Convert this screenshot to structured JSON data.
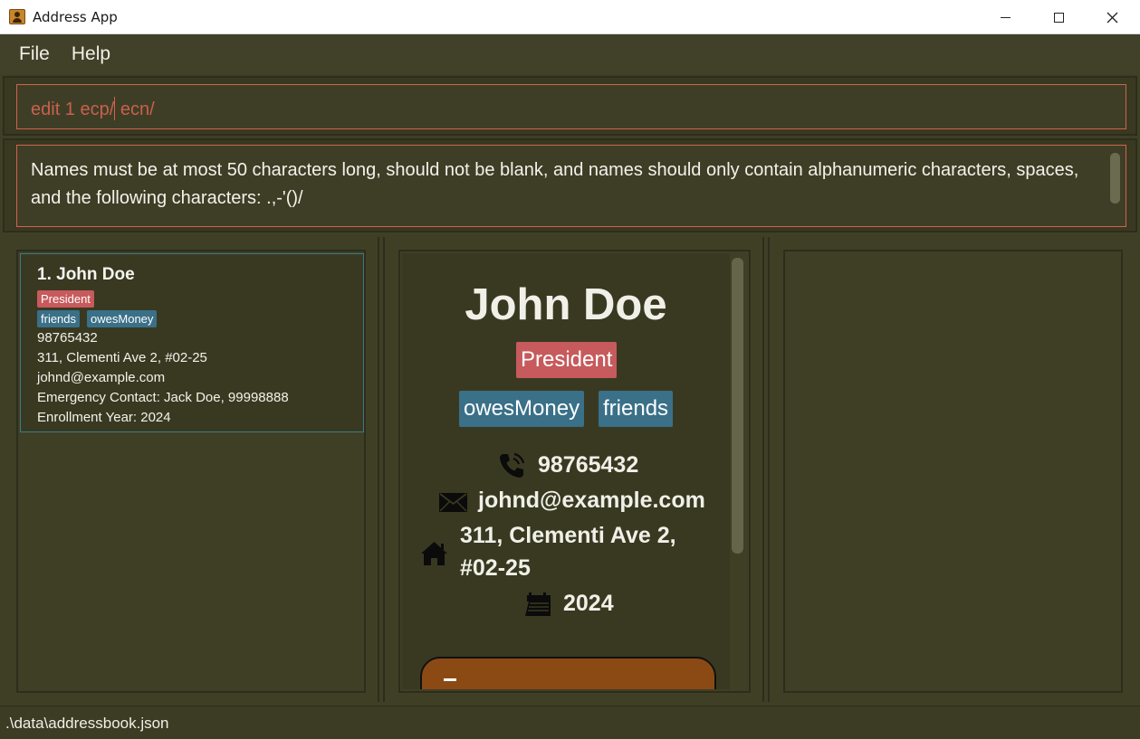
{
  "window": {
    "title": "Address App"
  },
  "menu": {
    "items": [
      "File",
      "Help"
    ]
  },
  "command": {
    "value_before_caret": "edit 1 ecp/",
    "value_after_caret": " ecn/"
  },
  "result": {
    "text": "Names must be at most 50 characters long, should not be blank, and names should only contain alphanumeric characters, spaces, and the following characters: .,-'()/"
  },
  "list": {
    "cards": [
      {
        "name": "1. John Doe",
        "role_tag": "President",
        "tags": [
          "friends",
          "owesMoney"
        ],
        "phone": "98765432",
        "address": "311, Clementi Ave 2, #02-25",
        "email": "johnd@example.com",
        "emergency": "Emergency Contact: Jack Doe, 99998888",
        "enrollment": "Enrollment Year: 2024"
      }
    ]
  },
  "detail": {
    "name": "John Doe",
    "role_tag": "President",
    "tags": [
      "owesMoney",
      "friends"
    ],
    "phone": "98765432",
    "email": "johnd@example.com",
    "address_line1": "311, Clementi Ave 2,",
    "address_line2": "#02-25",
    "year": "2024",
    "icons": [
      "phone-icon",
      "mail-icon",
      "home-icon",
      "calendar-icon"
    ]
  },
  "status": {
    "path": ".\\data\\addressbook.json"
  },
  "colors": {
    "background": "#3f3f26",
    "accent": "#d0624d",
    "tag_role": "#c75a5c",
    "tag": "#3a7088",
    "selected_border": "#3b7c85",
    "button": "#8b4a14"
  }
}
